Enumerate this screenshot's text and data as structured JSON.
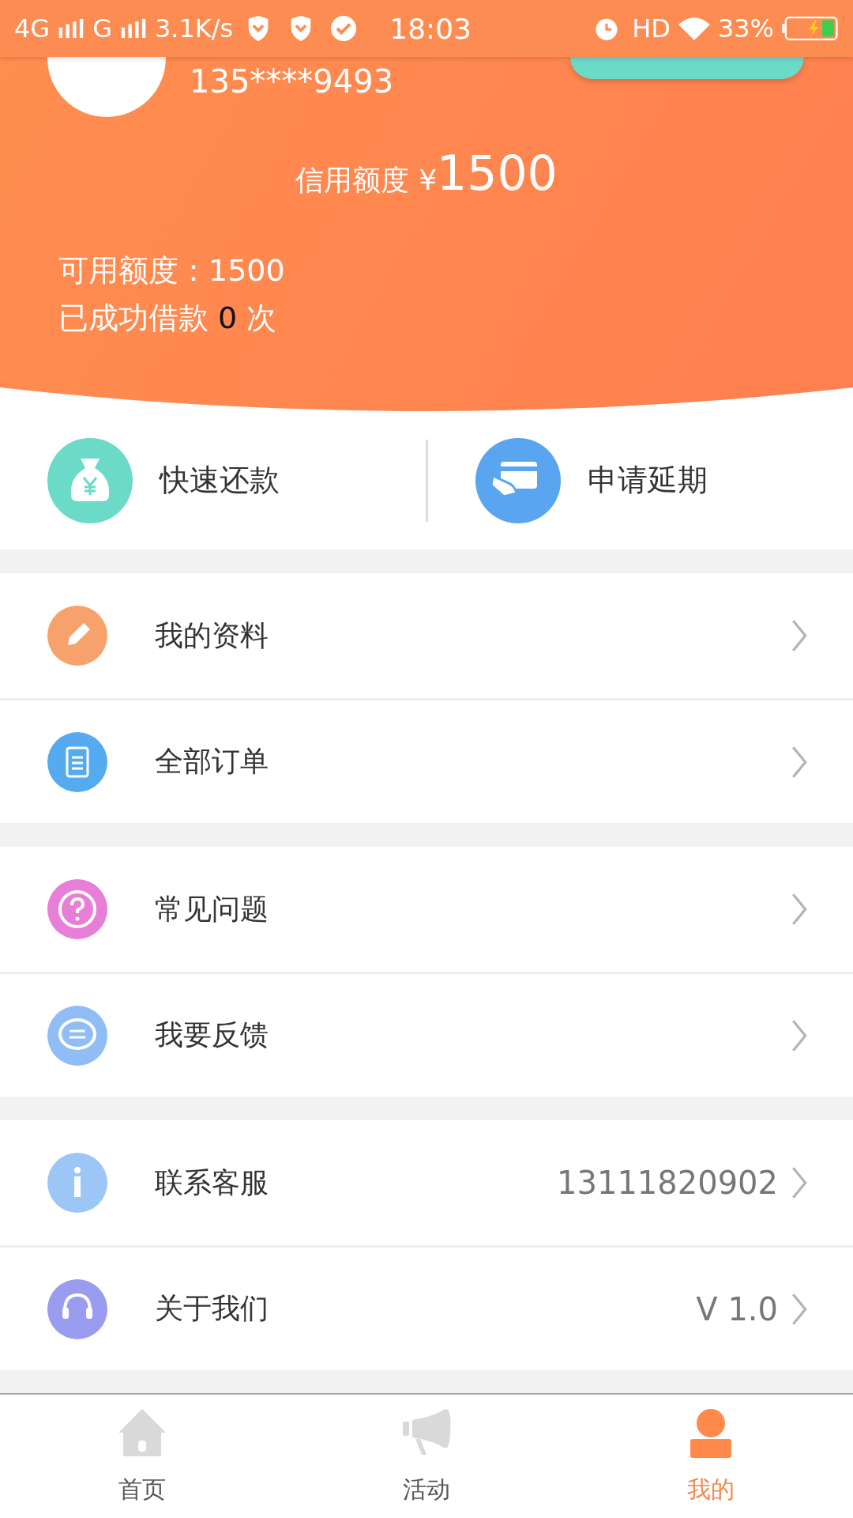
{
  "status_bar": {
    "network": "4G",
    "network2": "G",
    "speed": "3.1K/s",
    "time": "18:03",
    "hd": "HD",
    "battery": "33%"
  },
  "profile": {
    "phone": "135****9493",
    "credit_label": "信用额度",
    "credit_currency": "¥",
    "credit_amount": "1500",
    "available": "可用额度：1500",
    "loans_prefix": "已成功借款",
    "loans_count": "0",
    "loans_suffix": "次"
  },
  "quick_actions": [
    {
      "kind": "repay",
      "label": "快速还款"
    },
    {
      "kind": "extend",
      "label": "申请延期"
    }
  ],
  "menu_groups": [
    [
      {
        "kind": "profile",
        "label": "我的资料"
      },
      {
        "kind": "orders",
        "label": "全部订单"
      }
    ],
    [
      {
        "kind": "faq",
        "label": "常见问题"
      },
      {
        "kind": "feedback",
        "label": "我要反馈"
      }
    ],
    [
      {
        "kind": "service",
        "label": "联系客服",
        "value": "13111820902"
      },
      {
        "kind": "about",
        "label": "关于我们",
        "value": "V 1.0"
      }
    ]
  ],
  "tab_bar": [
    {
      "kind": "home",
      "label": "首页",
      "selected": false
    },
    {
      "kind": "activity",
      "label": "活动",
      "selected": false
    },
    {
      "kind": "mine",
      "label": "我的",
      "selected": true
    }
  ]
}
